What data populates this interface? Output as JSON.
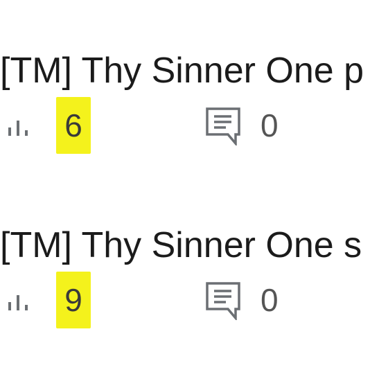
{
  "posts": [
    {
      "title": "[TM] Thy Sinner One p",
      "views": "6",
      "comments": "0"
    },
    {
      "title": "[TM] Thy Sinner One s",
      "views": "9",
      "comments": "0"
    }
  ],
  "icons": {
    "views": "bar-chart-icon",
    "comments": "comment-icon"
  },
  "colors": {
    "highlight": "#f4f21c",
    "title": "#1b1b1b",
    "icon": "#5f6368"
  }
}
